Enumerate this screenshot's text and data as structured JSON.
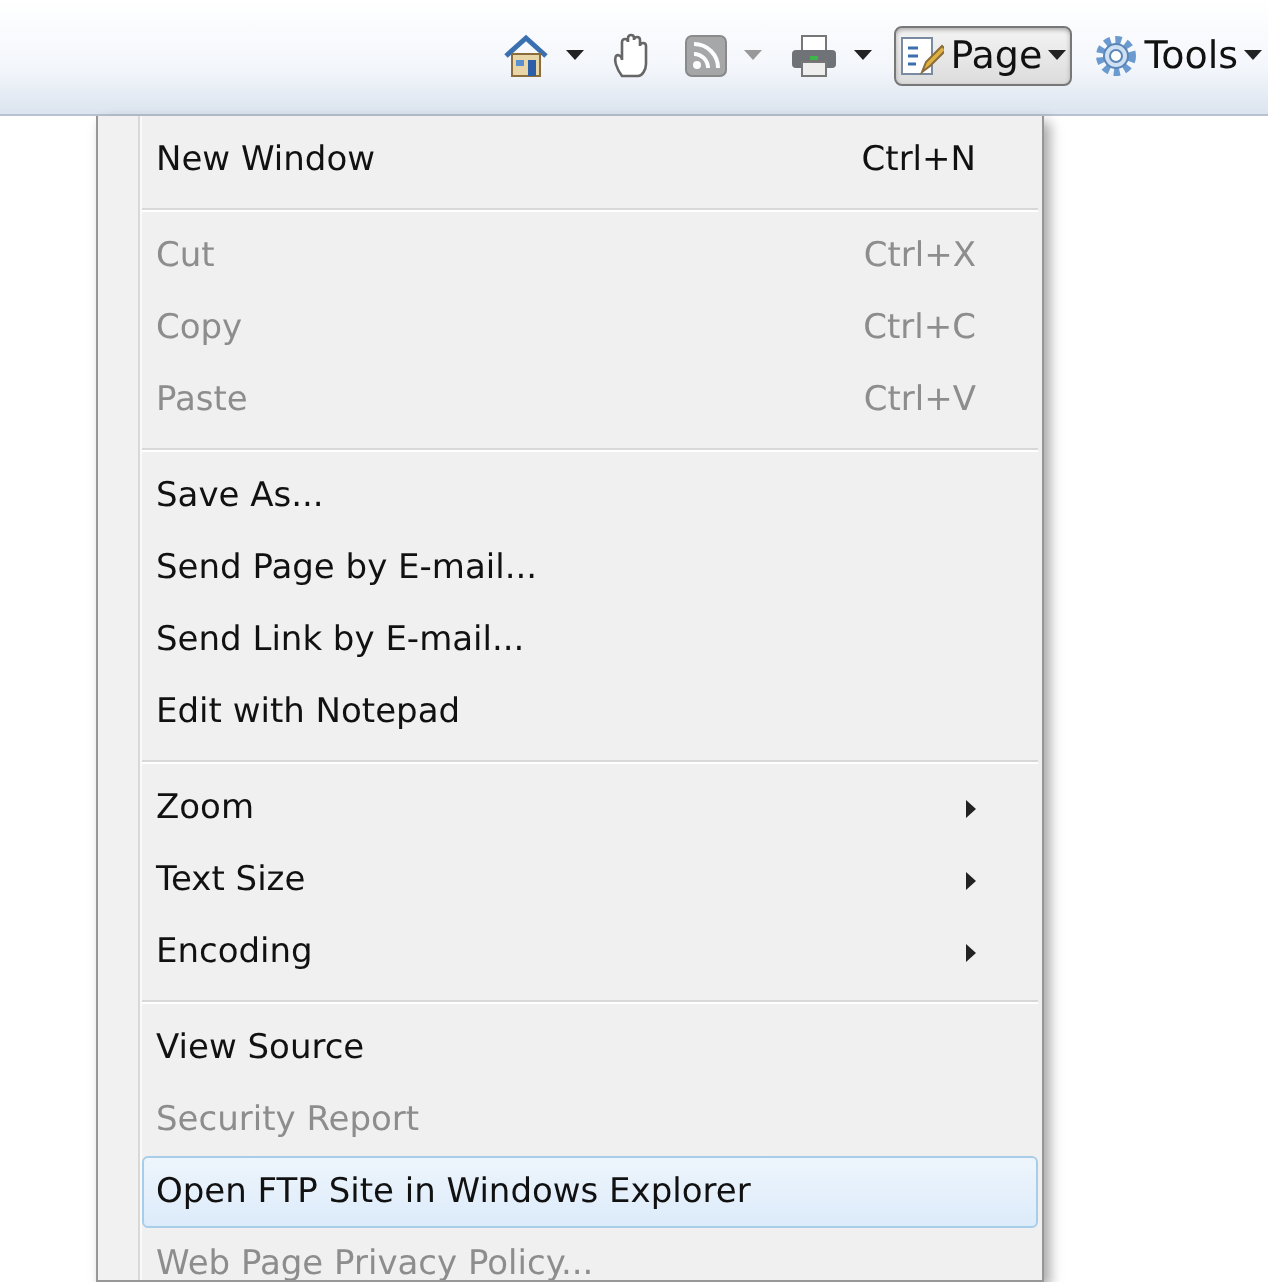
{
  "toolbar": {
    "items": [
      {
        "kind": "icon",
        "dropdown": true,
        "disabled": false
      },
      {
        "kind": "icon",
        "dropdown": false,
        "disabled": false
      },
      {
        "kind": "icon",
        "dropdown": true,
        "disabled": true
      },
      {
        "kind": "icon",
        "dropdown": true,
        "disabled": false
      },
      {
        "kind": "menu",
        "label": "Page",
        "pressed": true
      },
      {
        "kind": "menu",
        "label": "Tools",
        "pressed": false
      }
    ]
  },
  "menu": {
    "sections": [
      {
        "items": [
          {
            "label": "New Window",
            "shortcut": "Ctrl+N",
            "disabled": false,
            "submenu": false,
            "selected": false
          }
        ]
      },
      {
        "items": [
          {
            "label": "Cut",
            "shortcut": "Ctrl+X",
            "disabled": true,
            "submenu": false,
            "selected": false
          },
          {
            "label": "Copy",
            "shortcut": "Ctrl+C",
            "disabled": true,
            "submenu": false,
            "selected": false
          },
          {
            "label": "Paste",
            "shortcut": "Ctrl+V",
            "disabled": true,
            "submenu": false,
            "selected": false
          }
        ]
      },
      {
        "items": [
          {
            "label": "Save As...",
            "disabled": false,
            "submenu": false,
            "selected": false
          },
          {
            "label": "Send Page by E-mail...",
            "disabled": false,
            "submenu": false,
            "selected": false
          },
          {
            "label": "Send Link by E-mail...",
            "disabled": false,
            "submenu": false,
            "selected": false
          },
          {
            "label": "Edit with Notepad",
            "disabled": false,
            "submenu": false,
            "selected": false
          }
        ]
      },
      {
        "items": [
          {
            "label": "Zoom",
            "disabled": false,
            "submenu": true,
            "selected": false
          },
          {
            "label": "Text Size",
            "disabled": false,
            "submenu": true,
            "selected": false
          },
          {
            "label": "Encoding",
            "disabled": false,
            "submenu": true,
            "selected": false
          }
        ]
      },
      {
        "items": [
          {
            "label": "View Source",
            "disabled": false,
            "submenu": false,
            "selected": false
          },
          {
            "label": "Security Report",
            "disabled": true,
            "submenu": false,
            "selected": false
          },
          {
            "label": "Open FTP Site in Windows Explorer",
            "disabled": false,
            "submenu": false,
            "selected": true
          },
          {
            "label": "Web Page Privacy Policy...",
            "disabled": true,
            "submenu": false,
            "selected": false
          }
        ]
      }
    ]
  }
}
